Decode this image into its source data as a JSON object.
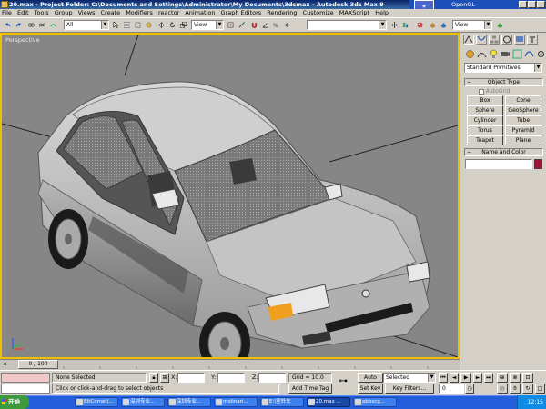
{
  "window": {
    "title": "20.max  - Project Folder: C:\\Documents and Settings\\Administrator\\My Documents\\3dsmax  - Autodesk 3ds Max 9",
    "renderer": "OpenGL"
  },
  "menu": [
    "File",
    "Edit",
    "Tools",
    "Group",
    "Views",
    "Create",
    "Modifiers",
    "reactor",
    "Animation",
    "Graph Editors",
    "Rendering",
    "Customize",
    "MAXScript",
    "Help"
  ],
  "toolbar": {
    "selection_filter": "All",
    "ref_coord": "View",
    "named_selection": "",
    "right_view": "View"
  },
  "viewport": {
    "label": "Perspective"
  },
  "command_panel": {
    "category": "Standard Primitives",
    "object_type": {
      "header": "Object Type",
      "autogrid": "AutoGrid",
      "buttons": [
        "Box",
        "Cone",
        "Sphere",
        "GeoSphere",
        "Cylinder",
        "Tube",
        "Torus",
        "Pyramid",
        "Teapot",
        "Plane"
      ]
    },
    "name_color": {
      "header": "Name and Color",
      "name_value": "",
      "swatch_color": "#a0143c"
    }
  },
  "timeline": {
    "frame": "0 / 100"
  },
  "status": {
    "selection": "None Selected",
    "prompt": "Click or click-and-drag to select objects",
    "x_label": "X:",
    "y_label": "Y:",
    "z_label": "Z:",
    "x_value": "",
    "y_value": "",
    "z_value": "",
    "grid": "Grid = 10.0",
    "add_time_tag": "Add Time Tag",
    "auto_key": "Auto Key",
    "set_key": "Set Key",
    "key_mode": "Selected",
    "key_filters": "Key Filters...",
    "current_frame": "0"
  },
  "taskbar": {
    "start": "开始",
    "tasks": [
      "BitComet(...",
      "深圳专业...",
      "深圳专业...",
      "molinari...",
      "E:\\室外车",
      "20.max ...",
      "abbscg..."
    ],
    "clock": "12:15"
  },
  "colors": {
    "viewport_bg": "#868686",
    "active_border": "#f0c000",
    "panel_bg": "#d4d0c8",
    "taskbar": "#245edc"
  }
}
